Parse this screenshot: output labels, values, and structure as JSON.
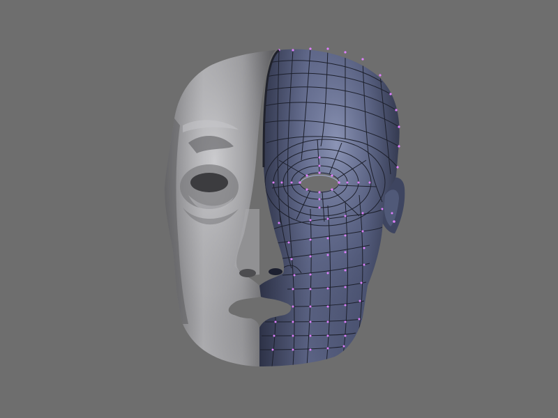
{
  "viewport": {
    "background": "#6e6e6e",
    "object": {
      "name": "head-mesh",
      "left_half_shading": "smooth-gray",
      "right_half_shading": "wireframe-on-shaded",
      "colors": {
        "gray_skin": "#8f8f92",
        "gray_shadow": "#4e4e51",
        "gray_highlight": "#c5c5c8",
        "blue_skin": "#4e5570",
        "blue_shadow": "#2a2f42",
        "blue_highlight": "#8e98b8",
        "wire": "#1c1f2b",
        "vertex": "#e080ff"
      }
    }
  }
}
